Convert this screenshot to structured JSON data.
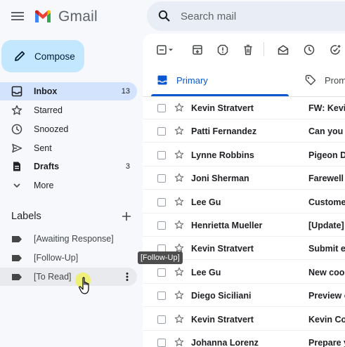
{
  "app": {
    "name": "Gmail"
  },
  "search": {
    "placeholder": "Search mail"
  },
  "compose": {
    "label": "Compose"
  },
  "nav": [
    {
      "label": "Inbox",
      "count": "13",
      "icon": "inbox-icon"
    },
    {
      "label": "Starred",
      "count": "",
      "icon": "star-icon"
    },
    {
      "label": "Snoozed",
      "count": "",
      "icon": "clock-icon"
    },
    {
      "label": "Sent",
      "count": "",
      "icon": "send-icon"
    },
    {
      "label": "Drafts",
      "count": "3",
      "icon": "draft-icon"
    },
    {
      "label": "More",
      "count": "",
      "icon": "chevron-down-icon"
    }
  ],
  "labels": {
    "heading": "Labels",
    "items": [
      {
        "label": "[Awaiting Response]"
      },
      {
        "label": "[Follow-Up]"
      },
      {
        "label": "[To Read]"
      }
    ]
  },
  "tooltip": {
    "text": "[Follow-Up]"
  },
  "tabs": [
    {
      "label": "Primary",
      "icon": "inbox-tab-icon"
    },
    {
      "label": "Promotions",
      "icon": "tag-icon"
    }
  ],
  "emails": [
    {
      "sender": "Kevin Stratvert",
      "subject": "FW: Kevin"
    },
    {
      "sender": "Patti Fernandez",
      "subject": "Can you w"
    },
    {
      "sender": "Lynne Robbins",
      "subject": "Pigeon De"
    },
    {
      "sender": "Joni Sherman",
      "subject": "Farewell L"
    },
    {
      "sender": "Lee Gu",
      "subject": "Customer"
    },
    {
      "sender": "Henrietta Mueller",
      "subject": "[Update]"
    },
    {
      "sender": "Kevin Stratvert",
      "subject": "Submit ex"
    },
    {
      "sender": "Lee Gu",
      "subject": "New cook"
    },
    {
      "sender": "Diego Siciliani",
      "subject": "Preview o"
    },
    {
      "sender": "Kevin Stratvert",
      "subject": "Kevin Co"
    },
    {
      "sender": "Johanna Lorenz",
      "subject": "Prepare y"
    }
  ],
  "colors": {
    "accent": "#0b57d0",
    "compose_bg": "#c2e7ff",
    "active_nav_bg": "#d3e3fd",
    "page_bg": "#f6f8fc"
  }
}
